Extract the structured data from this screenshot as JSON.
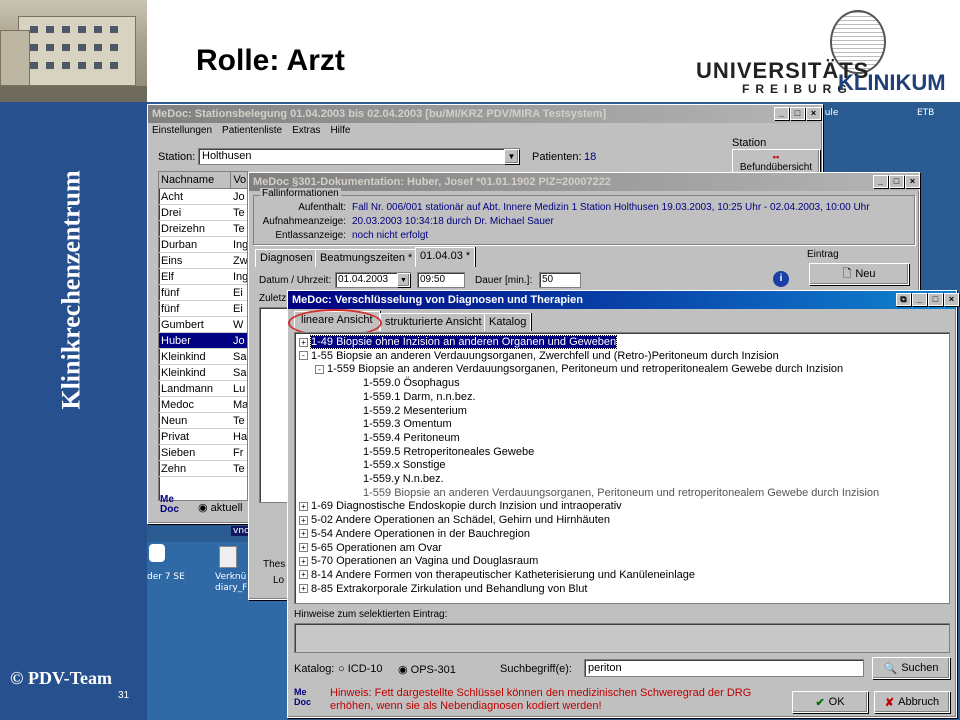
{
  "slide": {
    "title": "Rolle: Arzt",
    "side_text": "Klinikrechenzentrum",
    "copyright": "© PDV-Team",
    "page_number": "31",
    "logo": {
      "line1": "UNIVERSITÄTS",
      "line2": "FREIBURG",
      "line3": "KLINIKUM"
    }
  },
  "desktop": {
    "icons": [
      {
        "label": "hule"
      },
      {
        "label": "ETB"
      },
      {
        "label": "vncvie"
      },
      {
        "label": "der 7 SE"
      },
      {
        "label": "Verknü diary_F"
      }
    ]
  },
  "win1": {
    "title": "MeDoc: Stationsbelegung 01.04.2003 bis 02.04.2003   [bu/MI/KRZ PDV/MIRA Testsystem]",
    "menu": [
      "Einstellungen",
      "Patientenliste",
      "Extras",
      "Hilfe"
    ],
    "station_label": "Station:",
    "station_value": "Holthusen",
    "patients_label": "Patienten:",
    "patients_value": "18",
    "station_group": "Station",
    "befund_btn": "Befundübersicht",
    "col_nachname": "Nachname",
    "col_vorname": "Vo",
    "patients": [
      {
        "name": "Acht",
        "v": "Jo"
      },
      {
        "name": "Drei",
        "v": "Te"
      },
      {
        "name": "Dreizehn",
        "v": "Te"
      },
      {
        "name": "Durban",
        "v": "Ing"
      },
      {
        "name": "Eins",
        "v": "Zw"
      },
      {
        "name": "Elf",
        "v": "Ing"
      },
      {
        "name": "fünf",
        "v": "Ei"
      },
      {
        "name": "fünf",
        "v": "Ei"
      },
      {
        "name": "Gumbert",
        "v": "W"
      },
      {
        "name": "Huber",
        "v": "Jo"
      },
      {
        "name": "Kleinkind",
        "v": "Sa"
      },
      {
        "name": "Kleinkind",
        "v": "Sa"
      },
      {
        "name": "Landmann",
        "v": "Lu"
      },
      {
        "name": "Medoc",
        "v": "Ma"
      },
      {
        "name": "Neun",
        "v": "Te"
      },
      {
        "name": "Privat",
        "v": "Ha"
      },
      {
        "name": "Sieben",
        "v": "Fr"
      },
      {
        "name": "Zehn",
        "v": "Te"
      }
    ],
    "aktuell": "aktuell",
    "medoc": "Me Doc",
    "bottom_text": [
      "Thes",
      "Lo"
    ]
  },
  "win2": {
    "title": "MeDoc §301-Dokumentation: Huber, Josef *01.01.1902 PIZ=20007222",
    "group": "Fallinformationen",
    "aufenthalt_label": "Aufenthalt:",
    "aufenthalt_value": "Fall Nr. 006/001 stationär auf Abt. Innere Medizin 1 Station Holthusen 19.03.2003, 10:25 Uhr - 02.04.2003, 10:00 Uhr",
    "aufnahme_label": "Aufnahmeanzeige:",
    "aufnahme_value": "20.03.2003 10:34:18 durch Dr. Michael Sauer",
    "entlass_label": "Entlassanzeige:",
    "entlass_value": "noch nicht erfolgt",
    "tabs": [
      "Diagnosen",
      "Beatmungszeiten *",
      "01.04.03 *"
    ],
    "datum_label": "Datum / Uhrzeit:",
    "datum_value": "01.04.2003",
    "zeit_value": "09:50",
    "dauer_label": "Dauer [min.]:",
    "dauer_value": "50",
    "eintrag_group": "Eintrag",
    "neu_btn": "Neu",
    "zuletzt": "Zuletz"
  },
  "win3": {
    "title": "MeDoc: Verschlüsselung von Diagnosen und Therapien",
    "tabs": [
      "lineare Ansicht",
      "strukturierte Ansicht",
      "Katalog"
    ],
    "tree": [
      {
        "indent": 0,
        "pm": "+",
        "text": "1-49 Biopsie ohne Inzision an anderen Organen und Geweben",
        "selected": true
      },
      {
        "indent": 0,
        "pm": "-",
        "text": "1-55 Biopsie an anderen Verdauungsorganen, Zwerchfell und (Retro-)Peritoneum durch Inzision"
      },
      {
        "indent": 1,
        "pm": "-",
        "text": "1-559 Biopsie an anderen Verdauungsorganen, Peritoneum und retroperitonealem Gewebe durch Inzision"
      },
      {
        "indent": 2,
        "text": "1-559.0 Ösophagus",
        "bold": true
      },
      {
        "indent": 2,
        "text": "1-559.1 Darm, n.n.bez.",
        "bold": true
      },
      {
        "indent": 2,
        "text": "1-559.2 Mesenterium",
        "bold": true
      },
      {
        "indent": 2,
        "text": "1-559.3 Omentum",
        "bold": true
      },
      {
        "indent": 2,
        "text": "1-559.4 Peritoneum",
        "bold": true
      },
      {
        "indent": 2,
        "text": "1-559.5 Retroperitoneales Gewebe",
        "bold": true
      },
      {
        "indent": 2,
        "text": "1-559.x Sonstige",
        "bold": true
      },
      {
        "indent": 2,
        "text": "1-559.y N.n.bez.",
        "bold": true
      },
      {
        "indent": 2,
        "text": "1-559 Biopsie an anderen Verdauungsorganen, Peritoneum und retroperitonealem Gewebe durch Inzision",
        "grey": true
      },
      {
        "indent": 0,
        "pm": "+",
        "text": "1-69 Diagnostische Endoskopie durch Inzision und intraoperativ"
      },
      {
        "indent": 0,
        "pm": "+",
        "text": "5-02 Andere Operationen an Schädel, Gehirn und Hirnhäuten"
      },
      {
        "indent": 0,
        "pm": "+",
        "text": "5-54 Andere Operationen in der Bauchregion"
      },
      {
        "indent": 0,
        "pm": "+",
        "text": "5-65 Operationen am Ovar"
      },
      {
        "indent": 0,
        "pm": "+",
        "text": "5-70 Operationen an Vagina und Douglasraum"
      },
      {
        "indent": 0,
        "pm": "+",
        "text": "8-14 Andere Formen von therapeutischer Katheterisierung und Kanüleneinlage"
      },
      {
        "indent": 0,
        "pm": "+",
        "text": "8-85 Extrakorporale Zirkulation und Behandlung von Blut"
      }
    ],
    "hinweise_label": "Hinweise zum selektierten Eintrag:",
    "katalog_label": "Katalog:",
    "icd": "ICD-10",
    "ops": "OPS-301",
    "such_label": "Suchbegriff(e):",
    "such_value": "periton",
    "suchen_btn": "Suchen",
    "hint": "Hinweis: Fett dargestellte Schlüssel können den medizinischen Schweregrad der DRG erhöhen, wenn sie als Nebendiagnosen kodiert werden!",
    "ok_btn": "OK",
    "abbruch_btn": "Abbruch"
  }
}
